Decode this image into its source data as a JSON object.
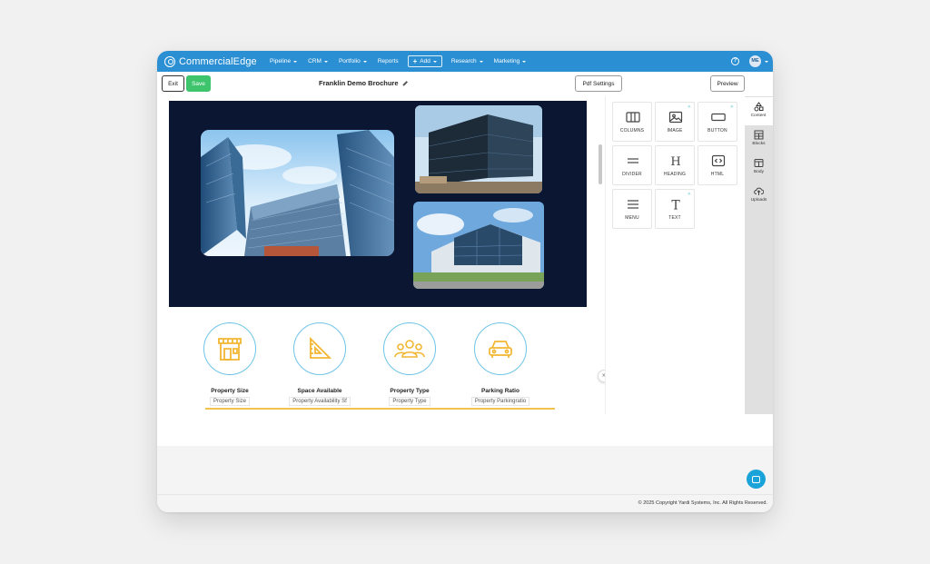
{
  "nav": {
    "brand": "CommercialEdge",
    "items": [
      {
        "label": "Pipeline",
        "dropdown": true
      },
      {
        "label": "CRM",
        "dropdown": true
      },
      {
        "label": "Portfolio",
        "dropdown": true
      },
      {
        "label": "Reports",
        "dropdown": false
      }
    ],
    "add_label": "Add",
    "items_after": [
      {
        "label": "Research",
        "dropdown": true
      },
      {
        "label": "Marketing",
        "dropdown": true
      }
    ],
    "help": "?",
    "avatar_initials": "ME"
  },
  "toolbar": {
    "exit_label": "Exit",
    "save_label": "Save",
    "doc_title": "Franklin Demo Brochure",
    "pdf_settings_label": "Pdf Settings",
    "preview_label": "Preview"
  },
  "features": [
    {
      "title": "Property Size",
      "tag": "Property Size",
      "icon": "building-icon"
    },
    {
      "title": "Space Available",
      "tag": "Property Availability Sf",
      "icon": "set-square-icon"
    },
    {
      "title": "Property Type",
      "tag": "Property Type",
      "icon": "people-icon"
    },
    {
      "title": "Parking Ratio",
      "tag": "Property Parkingratio",
      "icon": "car-icon"
    }
  ],
  "content_tiles": [
    {
      "label": "COLUMNS",
      "icon": "columns-icon",
      "badge": false
    },
    {
      "label": "IMAGE",
      "icon": "image-icon",
      "badge": true
    },
    {
      "label": "BUTTON",
      "icon": "button-icon",
      "badge": true
    },
    {
      "label": "DIVIDER",
      "icon": "divider-icon",
      "badge": false
    },
    {
      "label": "HEADING",
      "icon": "heading-icon",
      "badge": false
    },
    {
      "label": "HTML",
      "icon": "html-icon",
      "badge": false
    },
    {
      "label": "MENU",
      "icon": "menu-icon",
      "badge": false
    },
    {
      "label": "TEXT",
      "icon": "text-icon",
      "badge": true
    }
  ],
  "side_tabs": [
    {
      "label": "Content",
      "icon": "shapes-icon",
      "active": true
    },
    {
      "label": "Blocks",
      "icon": "blocks-icon",
      "active": false
    },
    {
      "label": "Body",
      "icon": "body-icon",
      "active": false
    },
    {
      "label": "Uploads",
      "icon": "upload-cloud-icon",
      "active": false
    }
  ],
  "footer": {
    "copyright": "© 2025 Copyright Yardi Systems, Inc. All Rights Reserved."
  },
  "colors": {
    "nav_bg": "#2b8fd3",
    "save_green": "#3ec46d",
    "hero_bg": "#0b1633",
    "feature_ring": "#6fc4e6",
    "feature_icon": "#f2b632",
    "chat_blue": "#1aa3d9"
  }
}
